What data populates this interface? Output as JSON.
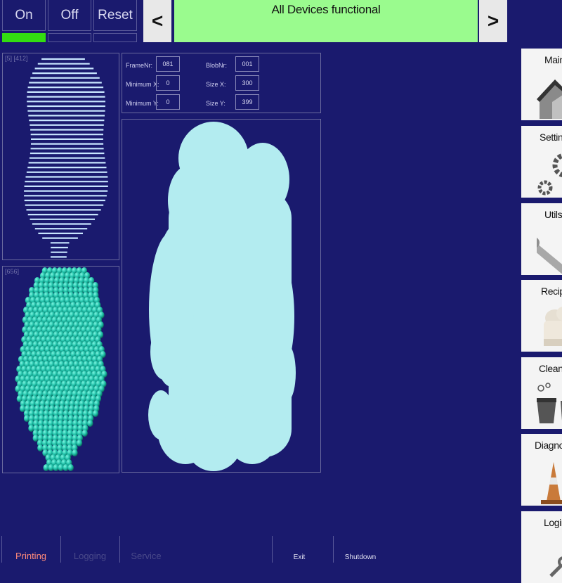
{
  "controls": {
    "on_label": "On",
    "off_label": "Off",
    "reset_label": "Reset",
    "on_active": true
  },
  "status": {
    "prev_label": "<",
    "next_label": ">",
    "message": "All Devices functional",
    "color": "#9afb8e"
  },
  "panels": {
    "top_tag": "[5] [412]",
    "bottom_tag": "[656]"
  },
  "blob_info": {
    "frame_nr_label": "FrameNr:",
    "frame_nr": "081",
    "blob_nr_label": "BlobNr:",
    "blob_nr": "001",
    "min_x_label": "Minimum X:",
    "min_x": "0",
    "size_x_label": "Size X:",
    "size_x": "300",
    "min_y_label": "Minimum Y:",
    "min_y": "0",
    "size_y_label": "Size Y:",
    "size_y": "399"
  },
  "menu": {
    "items": [
      {
        "label": "Main",
        "icon": "house-icon"
      },
      {
        "label": "Settings",
        "icon": "gears-icon"
      },
      {
        "label": "Utils",
        "icon": "wrench-icon"
      },
      {
        "label": "Recipes",
        "icon": "chef-hat-icon"
      },
      {
        "label": "Cleaning",
        "icon": "bucket-icon"
      },
      {
        "label": "Diagnostics",
        "icon": "traffic-cone-icon"
      },
      {
        "label": "Login",
        "icon": "key-icon"
      }
    ]
  },
  "bottom": {
    "printing_label": "Printing",
    "logging_label": "Logging",
    "service_label": "Service",
    "exit_label": "Exit",
    "shutdown_label": "Shutdown"
  },
  "colors": {
    "background": "#1a1a6e",
    "blob_fill": "#b3ecf0",
    "scan_lines": "#c8e6ff",
    "bead_color": "#1fc0a8",
    "active_tab": "#ff8a7a"
  }
}
